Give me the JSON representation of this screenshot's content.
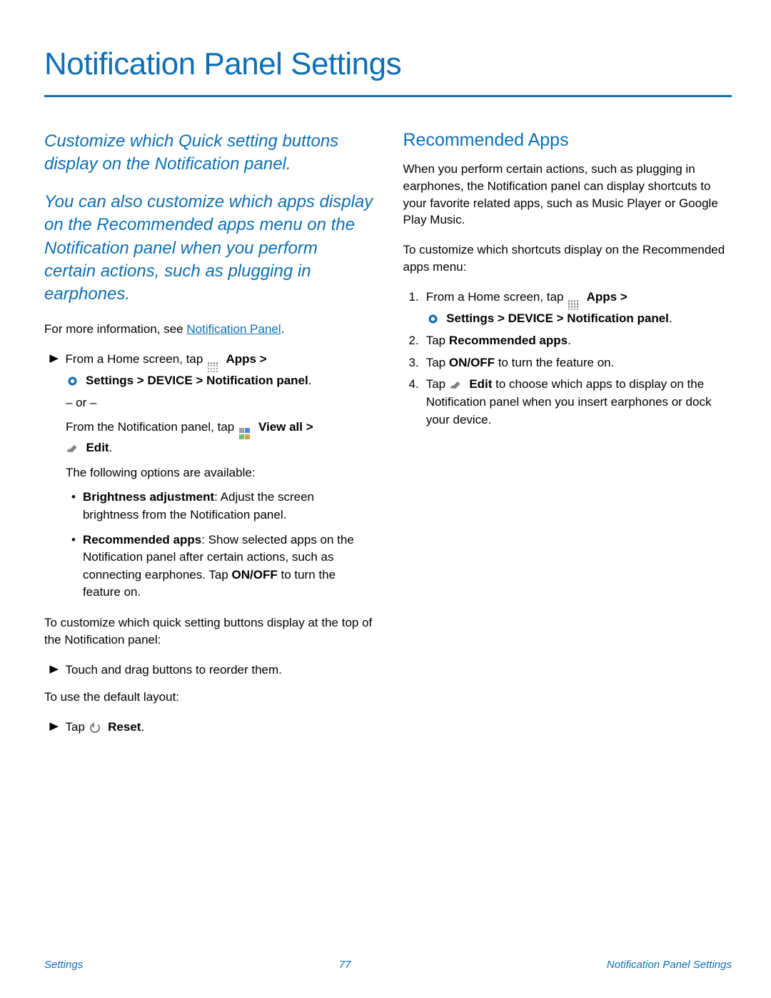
{
  "title": "Notification Panel Settings",
  "intro1": "Customize which Quick setting buttons display on the Notification panel.",
  "intro2": "You can also customize which apps display on the Recommended apps menu on the Notification panel when you perform certain actions, such as plugging in earphones.",
  "moreInfo_prefix": "For more information, see ",
  "moreInfo_link": "Notification Panel",
  "leftSteps": {
    "from_home": "From a Home screen, tap ",
    "apps_gt": "Apps >",
    "settings_path": "Settings > DEVICE > Notification panel",
    "or": "– or –",
    "from_panel": "From the Notification panel, tap ",
    "view_all_gt": "View all >",
    "edit": "Edit",
    "options_intro": "The following options are available:",
    "brightness_b": "Brightness adjustment",
    "brightness_t": ": Adjust the screen brightness from the Notification panel.",
    "recommended_b": "Recommended apps",
    "recommended_t": ": Show selected apps on the Notification panel after certain actions, such as connecting earphones. Tap ",
    "onoff": "ON/OFF",
    "recommended_t2": " to turn the feature on."
  },
  "customize_intro": "To customize which quick setting buttons display at the top of the Notification panel:",
  "reorder": "Touch and drag buttons to reorder them.",
  "default_intro": "To use the default layout:",
  "tap": "Tap ",
  "reset": "Reset",
  "right": {
    "heading": "Recommended Apps",
    "p1": "When you perform certain actions, such as plugging in earphones, the Notification panel can display shortcuts to your favorite related apps, such as Music Player or Google Play Music.",
    "p2": "To customize which shortcuts display on the Recommended apps menu:",
    "s1_a": "From a Home screen, tap ",
    "s1_apps": "Apps >",
    "s1_path": "Settings > DEVICE > Notification panel",
    "s2_a": "Tap ",
    "s2_b": "Recommended apps",
    "s3_a": "Tap ",
    "s3_b": "ON/OFF",
    "s3_c": " to turn the feature on.",
    "s4_a": "Tap ",
    "s4_edit": "Edit",
    "s4_b": " to choose which apps to display on the Notification panel when you insert earphones or dock your device."
  },
  "footer": {
    "left": "Settings",
    "center": "77",
    "right": "Notification Panel Settings"
  }
}
